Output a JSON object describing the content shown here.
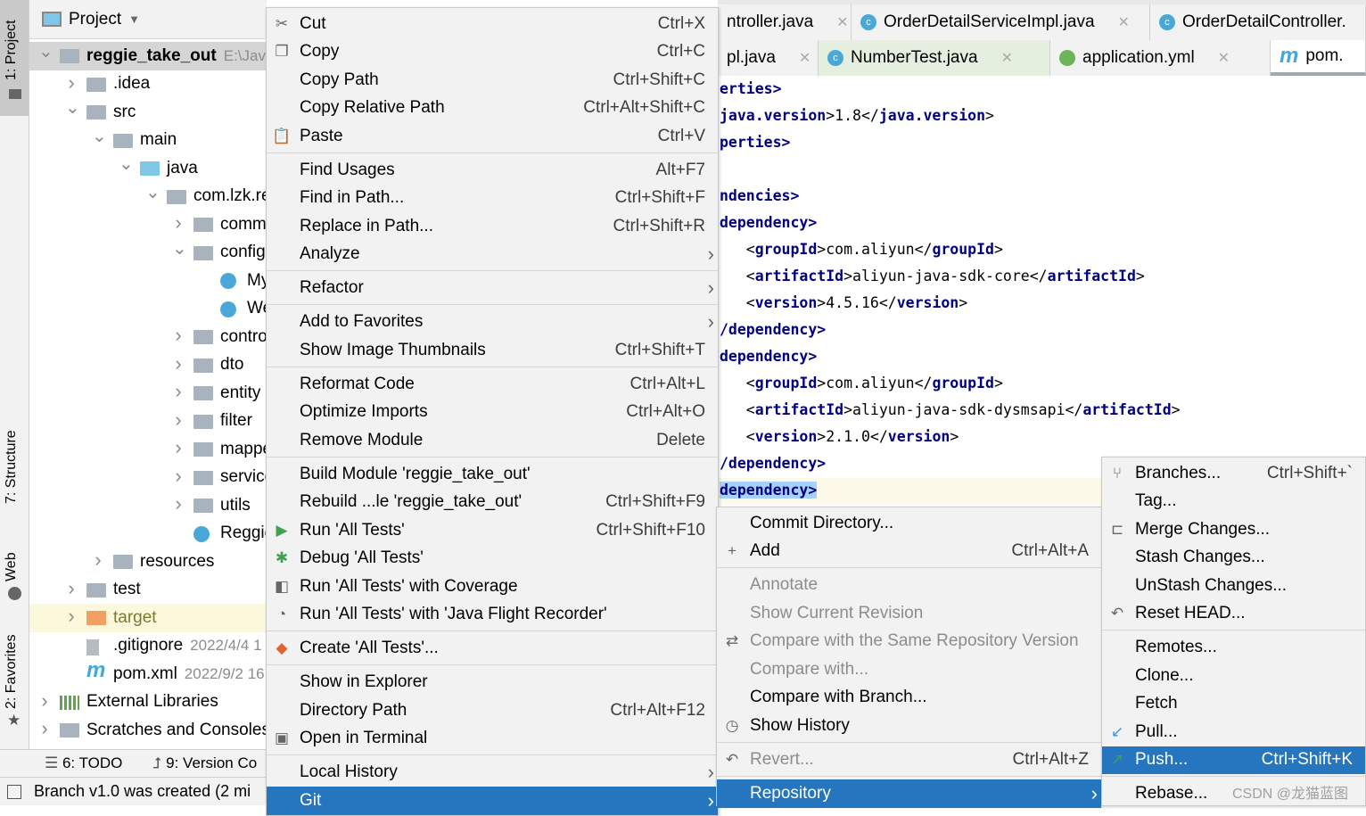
{
  "stripe": {
    "project": "1: Project",
    "structure": "7: Structure",
    "web": "Web",
    "favorites": "2: Favorites"
  },
  "project_panel": {
    "title": "Project",
    "tree": [
      {
        "level": 0,
        "label": "reggie_take_out",
        "arrow": "open",
        "icon": "module",
        "bold": true,
        "meta": "E:\\Java",
        "selected": true
      },
      {
        "level": 1,
        "label": ".idea",
        "arrow": "closed",
        "icon": "folder"
      },
      {
        "level": 1,
        "label": "src",
        "arrow": "open",
        "icon": "folder"
      },
      {
        "level": 2,
        "label": "main",
        "arrow": "open",
        "icon": "folder"
      },
      {
        "level": 3,
        "label": "java",
        "arrow": "open",
        "icon": "source-folder"
      },
      {
        "level": 4,
        "label": "com.lzk.re",
        "arrow": "open",
        "icon": "package"
      },
      {
        "level": 5,
        "label": "comm",
        "arrow": "closed",
        "icon": "package"
      },
      {
        "level": 5,
        "label": "config",
        "arrow": "open",
        "icon": "package"
      },
      {
        "level": 6,
        "label": "My",
        "icon": "class"
      },
      {
        "level": 6,
        "label": "We",
        "icon": "class"
      },
      {
        "level": 5,
        "label": "contro",
        "arrow": "closed",
        "icon": "package"
      },
      {
        "level": 5,
        "label": "dto",
        "arrow": "closed",
        "icon": "package"
      },
      {
        "level": 5,
        "label": "entity",
        "arrow": "closed",
        "icon": "package"
      },
      {
        "level": 5,
        "label": "filter",
        "arrow": "closed",
        "icon": "package"
      },
      {
        "level": 5,
        "label": "mappe",
        "arrow": "closed",
        "icon": "package"
      },
      {
        "level": 5,
        "label": "service",
        "arrow": "closed",
        "icon": "package"
      },
      {
        "level": 5,
        "label": "utils",
        "arrow": "closed",
        "icon": "package"
      },
      {
        "level": 5,
        "label": "Reggie",
        "icon": "spring-class"
      },
      {
        "level": 2,
        "label": "resources",
        "arrow": "closed",
        "icon": "resources-folder"
      },
      {
        "level": 1,
        "label": "test",
        "arrow": "closed",
        "icon": "folder"
      },
      {
        "level": 1,
        "label": "target",
        "arrow": "closed",
        "icon": "excluded-folder",
        "excluded": true
      },
      {
        "level": 1,
        "label": ".gitignore",
        "icon": "ignored-file",
        "meta": "2022/4/4 1"
      },
      {
        "level": 1,
        "label": "pom.xml",
        "icon": "maven",
        "meta": "2022/9/2 16"
      },
      {
        "level": 0,
        "label": "External Libraries",
        "arrow": "closed",
        "icon": "libraries"
      },
      {
        "level": 0,
        "label": "Scratches and Consoles",
        "arrow": "closed",
        "icon": "scratches"
      }
    ]
  },
  "bottom_bar": {
    "todo": "6: TODO",
    "vcs": "9: Version Co"
  },
  "status_bar": {
    "message": "Branch v1.0 was created (2 mi"
  },
  "editor": {
    "tabs_row1": [
      {
        "label": "ntroller.java"
      },
      {
        "label": "OrderDetailServiceImpl.java",
        "icon": "class"
      },
      {
        "label": "OrderDetailController.",
        "icon": "class"
      }
    ],
    "tabs_row2": [
      {
        "label": "pl.java"
      },
      {
        "label": "NumberTest.java",
        "icon": "test-class"
      },
      {
        "label": "application.yml",
        "icon": "spring-yml"
      },
      {
        "label": "pom.",
        "icon": "maven",
        "active": true
      }
    ],
    "code": [
      [
        [
          "t",
          "erties>"
        ]
      ],
      [
        [
          "t",
          "java.version"
        ],
        [
          "x",
          ">1.8</"
        ],
        [
          "t",
          "java.version"
        ],
        [
          "x",
          ">"
        ]
      ],
      [
        [
          "t",
          "perties>"
        ]
      ],
      [],
      [
        [
          "t",
          "ndencies>"
        ]
      ],
      [
        [
          "t",
          "dependency>"
        ]
      ],
      [
        [
          "x",
          "   <"
        ],
        [
          "t",
          "groupId"
        ],
        [
          "x",
          ">com.aliyun</"
        ],
        [
          "t",
          "groupId"
        ],
        [
          "x",
          ">"
        ]
      ],
      [
        [
          "x",
          "   <"
        ],
        [
          "t",
          "artifactId"
        ],
        [
          "x",
          ">aliyun-java-sdk-core</"
        ],
        [
          "t",
          "artifactId"
        ],
        [
          "x",
          ">"
        ]
      ],
      [
        [
          "x",
          "   <"
        ],
        [
          "t",
          "version"
        ],
        [
          "x",
          ">4.5.16</"
        ],
        [
          "t",
          "version"
        ],
        [
          "x",
          ">"
        ]
      ],
      [
        [
          "t",
          "/dependency>"
        ]
      ],
      [
        [
          "t",
          "dependency>"
        ]
      ],
      [
        [
          "x",
          "   <"
        ],
        [
          "t",
          "groupId"
        ],
        [
          "x",
          ">com.aliyun</"
        ],
        [
          "t",
          "groupId"
        ],
        [
          "x",
          ">"
        ]
      ],
      [
        [
          "x",
          "   <"
        ],
        [
          "t",
          "artifactId"
        ],
        [
          "x",
          ">aliyun-java-sdk-dysmsapi</"
        ],
        [
          "t",
          "artifactId"
        ],
        [
          "x",
          ">"
        ]
      ],
      [
        [
          "x",
          "   <"
        ],
        [
          "t",
          "version"
        ],
        [
          "x",
          ">2.1.0</"
        ],
        [
          "t",
          "version"
        ],
        [
          "x",
          ">"
        ]
      ],
      [
        [
          "t",
          "/dependency>"
        ]
      ],
      [
        [
          "t",
          "dependency>"
        ]
      ]
    ]
  },
  "context_menu": [
    {
      "label": "Cut",
      "shortcut": "Ctrl+X",
      "icon": "scissors"
    },
    {
      "label": "Copy",
      "shortcut": "Ctrl+C",
      "icon": "copy"
    },
    {
      "label": "Copy Path",
      "shortcut": "Ctrl+Shift+C"
    },
    {
      "label": "Copy Relative Path",
      "shortcut": "Ctrl+Alt+Shift+C"
    },
    {
      "label": "Paste",
      "shortcut": "Ctrl+V",
      "icon": "clipboard"
    },
    {
      "sep": true
    },
    {
      "label": "Find Usages",
      "shortcut": "Alt+F7"
    },
    {
      "label": "Find in Path...",
      "shortcut": "Ctrl+Shift+F"
    },
    {
      "label": "Replace in Path...",
      "shortcut": "Ctrl+Shift+R"
    },
    {
      "label": "Analyze",
      "submenu": true
    },
    {
      "sep": true
    },
    {
      "label": "Refactor",
      "submenu": true
    },
    {
      "sep": true
    },
    {
      "label": "Add to Favorites",
      "submenu": true
    },
    {
      "label": "Show Image Thumbnails",
      "shortcut": "Ctrl+Shift+T"
    },
    {
      "sep": true
    },
    {
      "label": "Reformat Code",
      "shortcut": "Ctrl+Alt+L"
    },
    {
      "label": "Optimize Imports",
      "shortcut": "Ctrl+Alt+O"
    },
    {
      "label": "Remove Module",
      "shortcut": "Delete"
    },
    {
      "sep": true
    },
    {
      "label": "Build Module 'reggie_take_out'"
    },
    {
      "label": "Rebuild ...le 'reggie_take_out'",
      "shortcut": "Ctrl+Shift+F9"
    },
    {
      "label": "Run 'All Tests'",
      "shortcut": "Ctrl+Shift+F10",
      "icon": "run"
    },
    {
      "label": "Debug 'All Tests'",
      "icon": "debug"
    },
    {
      "label": "Run 'All Tests' with Coverage",
      "icon": "coverage"
    },
    {
      "label": "Run 'All Tests' with 'Java Flight Recorder'",
      "icon": "profiler"
    },
    {
      "sep": true
    },
    {
      "label": "Create 'All Tests'...",
      "icon": "create-config"
    },
    {
      "sep": true
    },
    {
      "label": "Show in Explorer"
    },
    {
      "label": "Directory Path",
      "shortcut": "Ctrl+Alt+F12"
    },
    {
      "label": "Open in Terminal",
      "icon": "terminal"
    },
    {
      "sep": true
    },
    {
      "label": "Local History",
      "submenu": true
    },
    {
      "label": "Git",
      "submenu": true,
      "highlighted": true
    }
  ],
  "git_menu": [
    {
      "label": "Commit Directory..."
    },
    {
      "label": "Add",
      "shortcut": "Ctrl+Alt+A",
      "icon": "plus"
    },
    {
      "sep": true
    },
    {
      "label": "Annotate",
      "disabled": true
    },
    {
      "label": "Show Current Revision",
      "disabled": true
    },
    {
      "label": "Compare with the Same Repository Version",
      "disabled": true,
      "icon": "compare"
    },
    {
      "label": "Compare with...",
      "disabled": true
    },
    {
      "label": "Compare with Branch..."
    },
    {
      "label": "Show History",
      "icon": "clock"
    },
    {
      "sep": true
    },
    {
      "label": "Revert...",
      "shortcut": "Ctrl+Alt+Z",
      "disabled": true,
      "icon": "revert"
    },
    {
      "sep": true
    },
    {
      "label": "Repository",
      "submenu": true,
      "highlighted": true
    }
  ],
  "repository_menu": [
    {
      "label": "Branches...",
      "shortcut": "Ctrl+Shift+`",
      "icon": "branch"
    },
    {
      "label": "Tag..."
    },
    {
      "label": "Merge Changes...",
      "icon": "merge"
    },
    {
      "label": "Stash Changes..."
    },
    {
      "label": "UnStash Changes..."
    },
    {
      "label": "Reset HEAD...",
      "icon": "reset"
    },
    {
      "sep": true
    },
    {
      "label": "Remotes..."
    },
    {
      "label": "Clone..."
    },
    {
      "label": "Fetch"
    },
    {
      "label": "Pull...",
      "icon": "pull"
    },
    {
      "label": "Push...",
      "shortcut": "Ctrl+Shift+K",
      "icon": "push",
      "highlighted": true
    },
    {
      "sep": true
    },
    {
      "label": "Rebase..."
    }
  ],
  "watermark": "CSDN @龙猫蓝图",
  "colors": {
    "selection": "#2675bf",
    "menu_bg": "#f2f2f2",
    "xml_tag": "#000080",
    "excluded_folder": "#f0a060"
  }
}
